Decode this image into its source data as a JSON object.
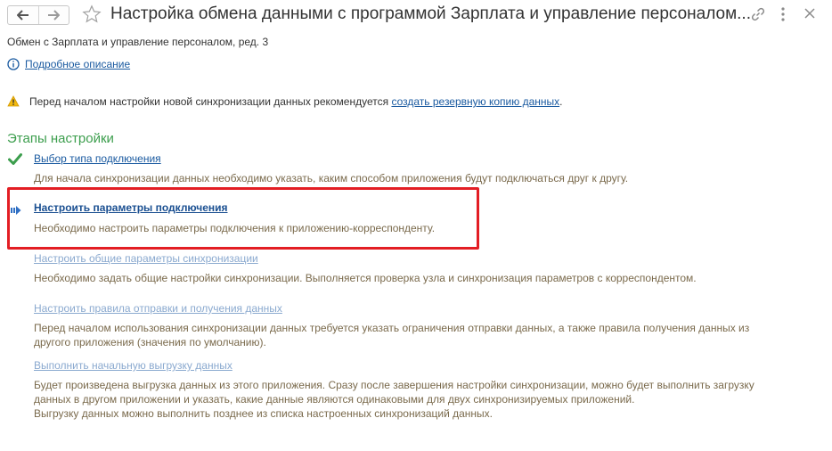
{
  "window": {
    "title": "Настройка обмена данными с программой Зарплата и управление персоналом...",
    "subtitle": "Обмен с Зарплата и управление персоналом, ред. 3"
  },
  "toolbar": {
    "back_icon": "arrow-left-icon",
    "forward_icon": "arrow-right-icon",
    "favorite_icon": "star-icon",
    "link_icon": "link-icon",
    "menu_icon": "more-vert-icon",
    "close_icon": "close-icon"
  },
  "info": {
    "link_label": "Подробное описание"
  },
  "warning": {
    "text": "Перед началом настройки новой синхронизации данных рекомендуется",
    "link_label": "создать резервную копию данных",
    "suffix": "."
  },
  "steps": {
    "title": "Этапы настройки",
    "items": [
      {
        "label": "Выбор типа подключения",
        "description": "Для начала синхронизации данных необходимо указать, каким способом приложения будут подключаться друг к другу.",
        "status": "done"
      },
      {
        "label": "Настроить параметры подключения",
        "description": "Необходимо настроить параметры подключения к приложению-корреспонденту.",
        "status": "current"
      },
      {
        "label": "Настроить общие параметры синхронизации",
        "description": "Необходимо задать общие настройки синхронизации. Выполняется проверка узла и синхронизация параметров с корреспондентом.",
        "status": "pending"
      },
      {
        "label": "Настроить правила отправки и получения данных",
        "description_lines": [
          "Перед началом использования синхронизации данных требуется указать ограничения отправки данных, а также правила получения данных из",
          "другого приложения (значения по умолчанию)."
        ],
        "status": "pending"
      },
      {
        "label": "Выполнить начальную выгрузку данных",
        "description_lines": [
          "Будет произведена выгрузка данных из этого приложения. Сразу после завершения настройки синхронизации, можно будет выполнить загрузку",
          "данных в другом приложении и указать, какие данные являются одинаковыми для двух синхронизируемых приложений.",
          "Выгрузку данных можно выполнить позднее из списка настроенных синхронизаций данных."
        ],
        "status": "pending"
      }
    ]
  },
  "colors": {
    "accent_green": "#3c9e4d",
    "link": "#1a5aa0",
    "link_disabled": "#8aa9cf",
    "description": "#7a6a4c",
    "highlight_red": "#e31e24",
    "warning_yellow": "#f2b90f"
  }
}
